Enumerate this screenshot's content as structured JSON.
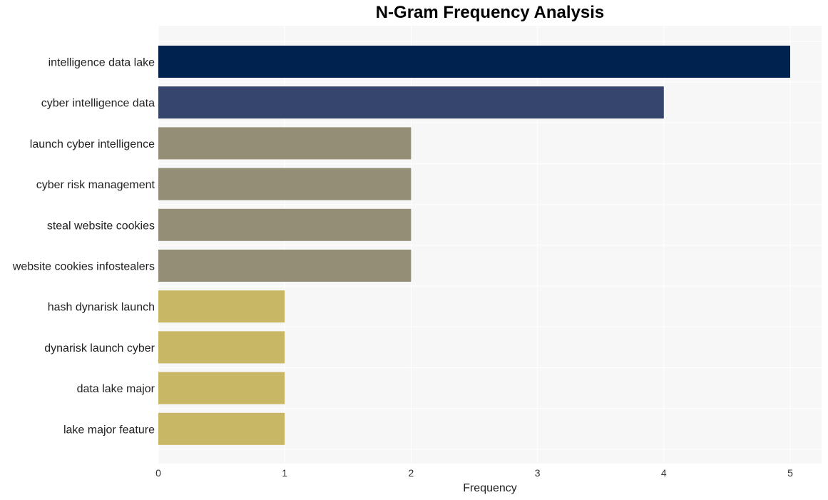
{
  "chart_data": {
    "type": "bar",
    "orientation": "horizontal",
    "title": "N-Gram Frequency Analysis",
    "xlabel": "Frequency",
    "ylabel": "",
    "xlim": [
      0,
      5.25
    ],
    "xticks": [
      0,
      1,
      2,
      3,
      4,
      5
    ],
    "grid": true,
    "categories": [
      "intelligence data lake",
      "cyber intelligence data",
      "launch cyber intelligence",
      "cyber risk management",
      "steal website cookies",
      "website cookies infostealers",
      "hash dynarisk launch",
      "dynarisk launch cyber",
      "data lake major",
      "lake major feature"
    ],
    "values": [
      5,
      4,
      2,
      2,
      2,
      2,
      1,
      1,
      1,
      1
    ],
    "colors": [
      "#00224e",
      "#35456c",
      "#948e77",
      "#948e77",
      "#948e77",
      "#948e77",
      "#c8b866",
      "#c8b866",
      "#c8b866",
      "#c8b866"
    ],
    "plot_background": "#f7f7f7",
    "grid_color": "#ffffff"
  }
}
